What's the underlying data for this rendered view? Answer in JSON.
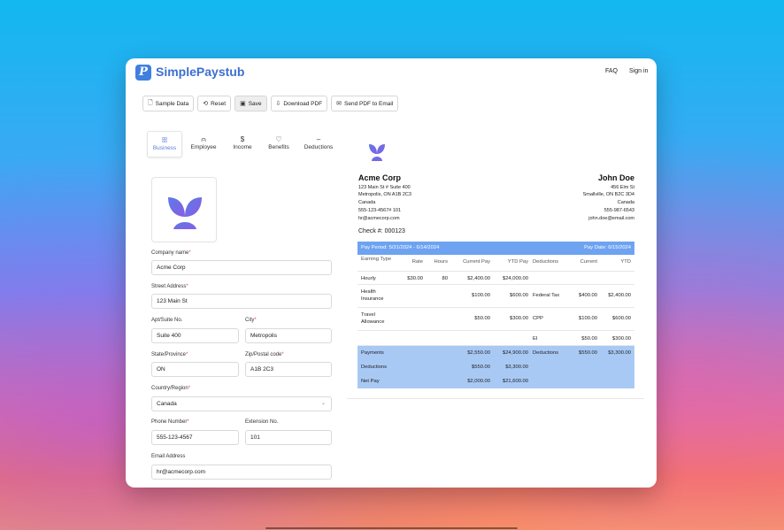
{
  "app": {
    "brand": "SimplePaystub",
    "logo_letter": "P",
    "nav": {
      "faq": "FAQ",
      "signin": "Sign in"
    }
  },
  "toolbar": {
    "sample": "Sample Data",
    "reset": "Reset",
    "save": "Save",
    "download": "Download PDF",
    "email": "Send PDF to Email"
  },
  "tabs": [
    {
      "label": "Business",
      "icon": "users-icon",
      "glyph": "ꕥ"
    },
    {
      "label": "Employee",
      "icon": "person-icon",
      "glyph": "⩀"
    },
    {
      "label": "Income",
      "icon": "dollar-icon",
      "glyph": "$"
    },
    {
      "label": "Benefits",
      "icon": "heart-icon",
      "glyph": "♡"
    },
    {
      "label": "Deductions",
      "icon": "minus-icon",
      "glyph": "–"
    }
  ],
  "form": {
    "company_name": {
      "label": "Company name",
      "value": "Acme Corp"
    },
    "street": {
      "label": "Street Address",
      "value": "123 Main St"
    },
    "apt": {
      "label": "Apt/Suite No.",
      "value": "Suite 400"
    },
    "city": {
      "label": "City",
      "value": "Metropolis"
    },
    "state": {
      "label": "State/Province",
      "value": "ON"
    },
    "zip": {
      "label": "Zip/Postal code",
      "value": "A1B 2C3"
    },
    "country": {
      "label": "Country/Region",
      "value": "Canada"
    },
    "phone": {
      "label": "Phone Number",
      "value": "555-123-4567"
    },
    "ext": {
      "label": "Extension No.",
      "value": "101"
    },
    "email": {
      "label": "Email Address",
      "value": "hr@acmecorp.com"
    },
    "required_mark": "*"
  },
  "preview": {
    "company": {
      "name": "Acme Corp",
      "lines": [
        "123 Main St # Suite 400",
        "Metropolis, ON A1B 2C3",
        "Canada",
        "555-123-4567# 101",
        "hr@acmecorp.com"
      ]
    },
    "employee": {
      "name": "John Doe",
      "lines": [
        "456 Elm St",
        "Smallville, ON B2C 3D4",
        "Canada",
        "555-987-6543",
        "john.doe@email.com"
      ]
    },
    "check": "Check #: 000123",
    "pay_period": "Pay Period: 5/31/2024 - 6/14/2024",
    "pay_date": "Pay Date: 6/15/2024",
    "headers": {
      "earning_type": "Earning Type",
      "rate": "Rate",
      "hours": "Hours",
      "current_pay": "Current Pay",
      "ytd_pay": "YTD Pay",
      "deductions": "Deductions",
      "current": "Current",
      "ytd": "YTD"
    },
    "rows": [
      {
        "type": "Hourly",
        "rate": "$30.00",
        "hours": "80",
        "current": "$2,400.00",
        "ytd": "$24,000.00",
        "ded": "",
        "ded_current": "",
        "ded_ytd": ""
      },
      {
        "type": "Health Insurance",
        "rate": "",
        "hours": "",
        "current": "$100.00",
        "ytd": "$600.00",
        "ded": "Federal Tax",
        "ded_current": "$400.00",
        "ded_ytd": "$2,400.00"
      },
      {
        "type": "Travel Allowance",
        "rate": "",
        "hours": "",
        "current": "$50.00",
        "ytd": "$300.00",
        "ded": "CPP",
        "ded_current": "$100.00",
        "ded_ytd": "$600.00"
      },
      {
        "type": "",
        "rate": "",
        "hours": "",
        "current": "",
        "ytd": "",
        "ded": "EI",
        "ded_current": "$50.00",
        "ded_ytd": "$300.00"
      }
    ],
    "summary": [
      {
        "label": "Payments",
        "current": "$2,550.00",
        "ytd": "$24,900.00",
        "ded": "Deductions",
        "ded_current": "$550.00",
        "ded_ytd": "$3,300.00"
      },
      {
        "label": "Deductions",
        "current": "$550.00",
        "ytd": "$3,300.00",
        "ded": "",
        "ded_current": "",
        "ded_ytd": ""
      },
      {
        "label": "Net Pay",
        "current": "$2,000.00",
        "ytd": "$21,600.00",
        "ded": "",
        "ded_current": "",
        "ded_ytd": ""
      }
    ]
  },
  "colors": {
    "accent": "#3f7fe0",
    "table_header": "#6ea3f1",
    "summary_bg": "#a9c9f5",
    "logo_gradient_start": "#5b7be6",
    "logo_gradient_end": "#8a5ce6"
  }
}
